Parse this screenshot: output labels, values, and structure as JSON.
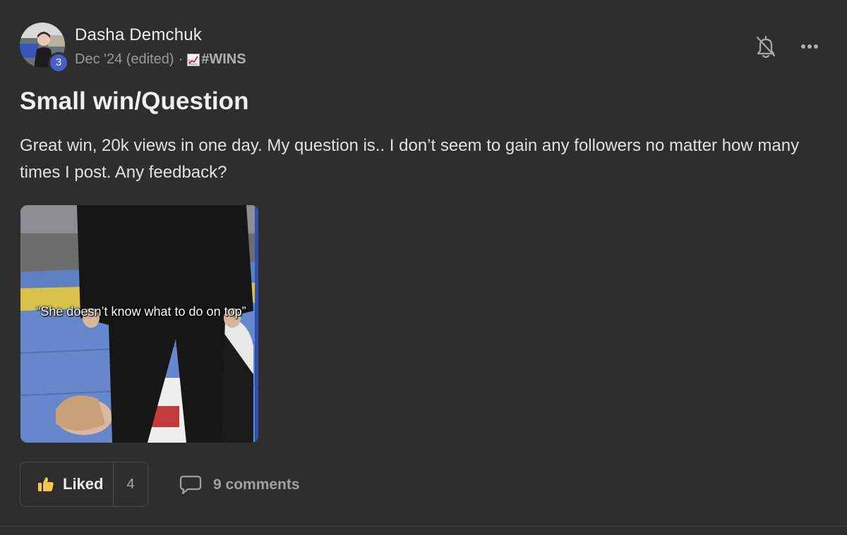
{
  "post": {
    "author": {
      "name": "Dasha Demchuk",
      "level": "3"
    },
    "meta": {
      "date": "Dec '24 (edited)",
      "separator": "·",
      "category": "#WINS",
      "category_icon": "chart-increasing-emoji"
    },
    "title": "Small win/Question",
    "body": "Great win, 20k views in one day. My question is.. I don’t seem to gain any followers no matter how many times I post. Any feedback?",
    "media": {
      "caption": "“She doesn’t know what to do on top”"
    },
    "actions": {
      "like_label": "Liked",
      "like_count": "4",
      "comments_label": "9 comments"
    }
  },
  "colors": {
    "background": "#2e2e2e",
    "level_badge": "#4a5cc9",
    "muted_text": "#9a9a9a"
  }
}
